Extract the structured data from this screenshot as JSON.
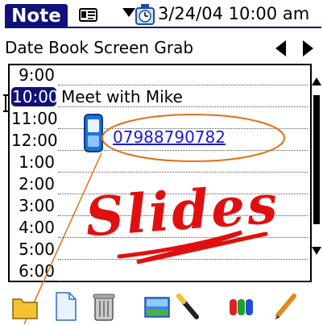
{
  "header": {
    "app_name": "Note",
    "datetime": "3/24/04 10:00 am"
  },
  "subtitle": "Date Book Screen Grab",
  "schedule": {
    "rows": [
      {
        "time": "9:00",
        "event": ""
      },
      {
        "time": "10:00",
        "event": "Meet with Mike",
        "selected": true
      },
      {
        "time": "11:00",
        "event": ""
      },
      {
        "time": "12:00",
        "event": ""
      },
      {
        "time": "1:00",
        "event": ""
      },
      {
        "time": "2:00",
        "event": ""
      },
      {
        "time": "3:00",
        "event": ""
      },
      {
        "time": "4:00",
        "event": ""
      },
      {
        "time": "5:00",
        "event": ""
      },
      {
        "time": "6:00",
        "event": ""
      }
    ],
    "phone_number": "07988790782"
  },
  "annotation": {
    "handwritten_text": "Slides",
    "ink_color": "#e01010",
    "circle_color": "#e0701a"
  },
  "colors": {
    "accent": "#11117a",
    "link": "#1a1ad6"
  },
  "toolbar": {
    "icons": [
      "folder-icon",
      "blank-page-icon",
      "trash-icon",
      "image-icon",
      "eraser-icon",
      "color-palette-icon",
      "pencil-icon"
    ]
  }
}
